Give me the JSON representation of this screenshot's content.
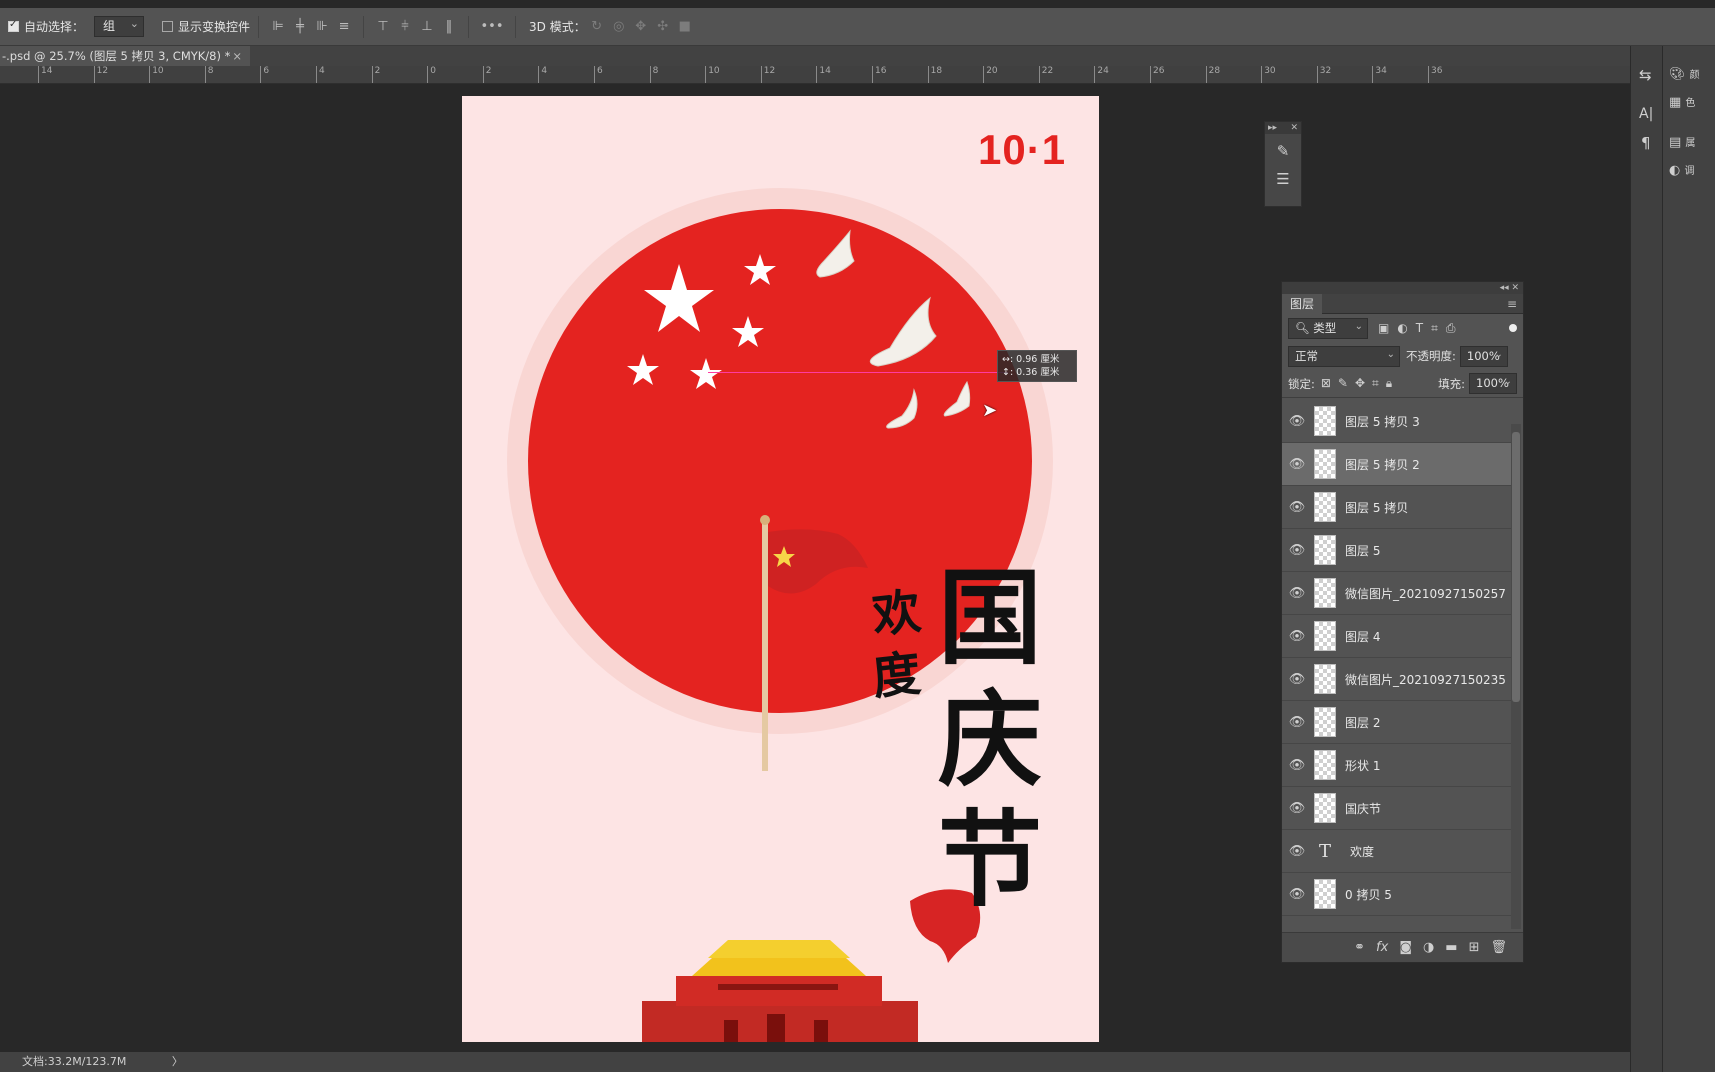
{
  "options_bar": {
    "auto_select_label": "自动选择：",
    "auto_select_value": "组",
    "show_transform_label": "显示变换控件",
    "more_label": "•••",
    "mode_3d_label": "3D 模式："
  },
  "document_tab": {
    "title": "-.psd @ 25.7% (图层 5 拷贝 3, CMYK/8) *",
    "close": "×"
  },
  "ruler": {
    "ticks": [
      "14",
      "12",
      "10",
      "8",
      "6",
      "4",
      "2",
      "0",
      "2",
      "4",
      "6",
      "8",
      "10",
      "12",
      "14",
      "16",
      "18",
      "20",
      "22",
      "24",
      "26",
      "28",
      "30",
      "32",
      "34",
      "36"
    ]
  },
  "poster": {
    "year_label": "10·1",
    "welcome_text_1": "欢",
    "welcome_text_2": "度",
    "title_char_1": "国",
    "title_char_2": "庆",
    "title_char_3": "节",
    "colors": {
      "background": "#fde4e4",
      "circle": "#e42320",
      "title": "#111111",
      "accent": "#e42320"
    }
  },
  "measure_tooltip": {
    "line1": "↔: 0.96 厘米",
    "line2": "↕: 0.36 厘米"
  },
  "layers_panel": {
    "tab_title": "图层",
    "filter_type": "类型",
    "blend_mode": "正常",
    "opacity_label": "不透明度:",
    "opacity_value": "100%",
    "lock_label": "锁定:",
    "fill_label": "填充:",
    "fill_value": "100%",
    "layers": [
      {
        "name": "图层 5 拷贝 3",
        "kind": "pixel",
        "selected": false
      },
      {
        "name": "图层 5 拷贝 2",
        "kind": "pixel",
        "selected": true
      },
      {
        "name": "图层 5 拷贝",
        "kind": "pixel",
        "selected": false
      },
      {
        "name": "图层 5",
        "kind": "pixel",
        "selected": false
      },
      {
        "name": "微信图片_20210927150257",
        "kind": "pixel",
        "selected": false
      },
      {
        "name": "图层 4",
        "kind": "pixel",
        "selected": false
      },
      {
        "name": "微信图片_20210927150235",
        "kind": "pixel",
        "selected": false
      },
      {
        "name": "图层 2",
        "kind": "pixel",
        "selected": false
      },
      {
        "name": "形状 1",
        "kind": "shape",
        "selected": false
      },
      {
        "name": "国庆节",
        "kind": "pixel",
        "selected": false
      },
      {
        "name": "欢度",
        "kind": "text",
        "selected": false
      },
      {
        "name": "0 拷贝 5",
        "kind": "pixel",
        "selected": false
      }
    ]
  },
  "dock": {
    "label_1": "颜",
    "label_2": "色",
    "label_3": "属",
    "label_4": "调"
  },
  "status_bar": {
    "doc_size": "文档:33.2M/123.7M",
    "arrow": "〉"
  }
}
